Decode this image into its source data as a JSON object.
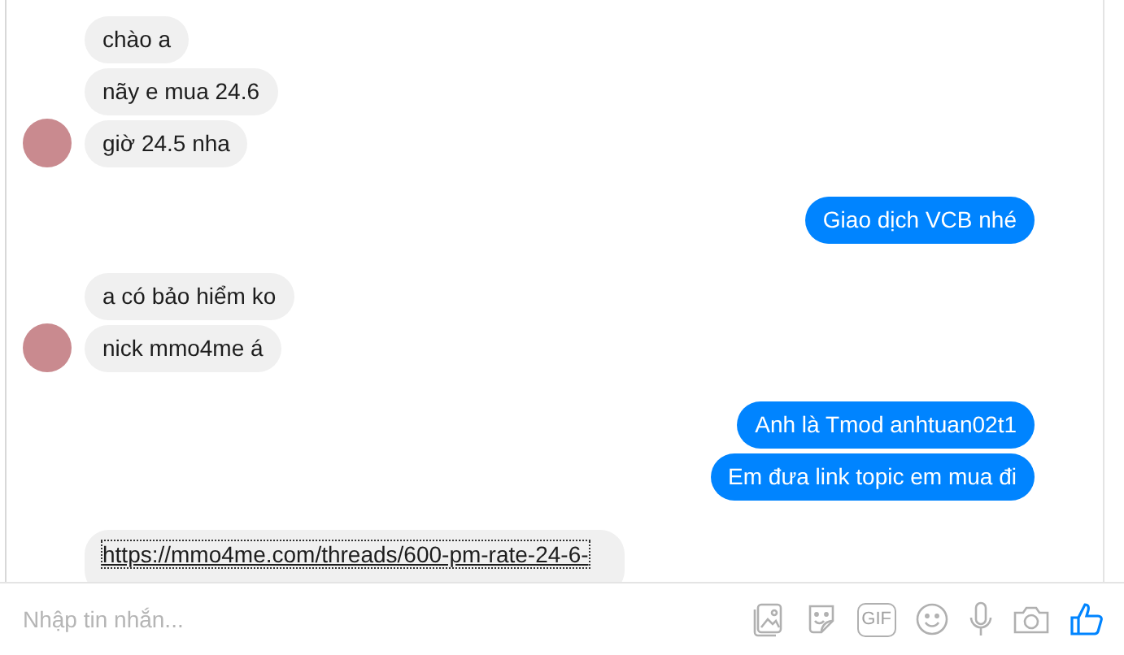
{
  "groups": [
    {
      "kind": "incoming",
      "avatar": true,
      "messages": [
        {
          "kind": "text",
          "text": "chào a"
        },
        {
          "kind": "text",
          "text": "nãy e mua 24.6"
        },
        {
          "kind": "text",
          "text": "giờ 24.5 nha"
        }
      ]
    },
    {
      "kind": "outgoing",
      "avatar": false,
      "messages": [
        {
          "kind": "text",
          "text": "Giao dịch VCB nhé"
        }
      ]
    },
    {
      "kind": "incoming",
      "avatar": true,
      "messages": [
        {
          "kind": "text",
          "text": "a có bảo hiểm ko"
        },
        {
          "kind": "text",
          "text": "nick mmo4me á"
        }
      ]
    },
    {
      "kind": "outgoing",
      "avatar": false,
      "messages": [
        {
          "kind": "text",
          "text": "Anh là Tmod anhtuan02t1"
        },
        {
          "kind": "text",
          "text": "Em đưa link topic em mua đi"
        }
      ]
    },
    {
      "kind": "incoming",
      "avatar": false,
      "messages": [
        {
          "kind": "link",
          "text": "https://mmo4me.com/threads/600-pm-rate-24-6-"
        }
      ]
    }
  ],
  "composer": {
    "placeholder": "Nhập tin nhắn...",
    "gif_label": "GIF"
  }
}
